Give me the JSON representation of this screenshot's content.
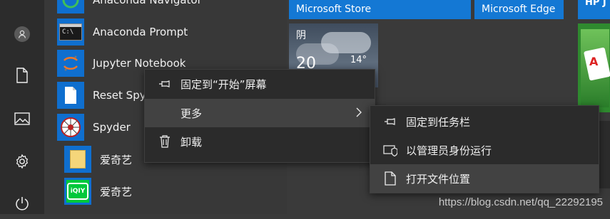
{
  "rail": {
    "items": [
      {
        "name": "user-avatar",
        "icon": "user-icon"
      },
      {
        "name": "documents",
        "icon": "document-icon"
      },
      {
        "name": "pictures",
        "icon": "picture-icon"
      },
      {
        "name": "settings",
        "icon": "gear-icon"
      },
      {
        "name": "power",
        "icon": "power-icon"
      }
    ]
  },
  "applist": {
    "items": [
      {
        "label": "Anaconda Navigator",
        "icon": "anaconda-navigator-icon"
      },
      {
        "label": "Anaconda Prompt",
        "icon": "terminal-icon"
      },
      {
        "label": "Jupyter Notebook",
        "icon": "jupyter-icon"
      },
      {
        "label": "Reset Spyder Settings",
        "icon": "document-icon"
      },
      {
        "label": "Spyder",
        "icon": "spyder-icon"
      },
      {
        "label": "爱奇艺",
        "icon": "folder-icon"
      },
      {
        "label": "爱奇艺",
        "icon": "iqiyi-icon"
      }
    ]
  },
  "tiles": {
    "store_label": "Microsoft Store",
    "edge_label": "Microsoft Edge",
    "hp_label": "HP J",
    "weather_condition": "阴",
    "weather_temp": "14°",
    "weather_temp_partial": "20",
    "accent_blue": "#1478d4"
  },
  "context_menu": {
    "items": [
      {
        "label": "固定到“开始”屏幕",
        "icon": "pin-icon"
      },
      {
        "label": "更多",
        "icon": "",
        "has_submenu": true
      },
      {
        "label": "卸载",
        "icon": "trash-icon"
      }
    ]
  },
  "submenu": {
    "items": [
      {
        "label": "固定到任务栏",
        "icon": "pin-icon"
      },
      {
        "label": "以管理员身份运行",
        "icon": "shield-icon"
      },
      {
        "label": "打开文件位置",
        "icon": "file-icon"
      }
    ]
  },
  "watermark": "https://blog.csdn.net/qq_22292195"
}
